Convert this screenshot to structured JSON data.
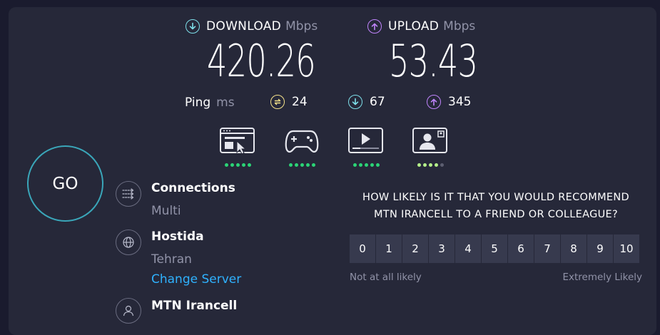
{
  "download": {
    "label": "DOWNLOAD",
    "unit": "Mbps",
    "value": "420.26"
  },
  "upload": {
    "label": "UPLOAD",
    "unit": "Mbps",
    "value": "53.43"
  },
  "ping": {
    "label": "Ping",
    "unit": "ms",
    "idle": "24",
    "download": "67",
    "upload": "345"
  },
  "quality": [
    {
      "icon": "web-browsing-icon",
      "rating": 5
    },
    {
      "icon": "gaming-controller-icon",
      "rating": 5
    },
    {
      "icon": "video-streaming-icon",
      "rating": 5
    },
    {
      "icon": "video-call-icon",
      "rating": 4
    }
  ],
  "go_label": "GO",
  "connections": {
    "title": "Connections",
    "value": "Multi"
  },
  "server": {
    "name": "Hostida",
    "location": "Tehran",
    "change_label": "Change Server"
  },
  "provider": {
    "name": "MTN Irancell"
  },
  "survey": {
    "question_line1": "HOW LIKELY IS IT THAT YOU WOULD RECOMMEND",
    "question_line2": "MTN IRANCELL TO A FRIEND OR COLLEAGUE?",
    "scale": [
      "0",
      "1",
      "2",
      "3",
      "4",
      "5",
      "6",
      "7",
      "8",
      "9",
      "10"
    ],
    "low_label": "Not at all likely",
    "high_label": "Extremely Likely"
  },
  "colors": {
    "download_accent": "#7ee0ea",
    "upload_accent": "#c084fc",
    "ping_accent": "#f5e28a",
    "good_dot": "#2bd576",
    "fair_dot": "#b5f08a",
    "empty_dot": "#5c5e70",
    "go_ring": "#3aa6b9",
    "link": "#2fb2ff"
  }
}
